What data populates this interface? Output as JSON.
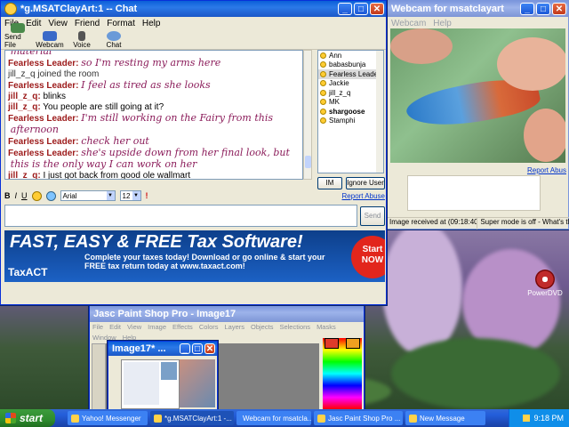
{
  "chat": {
    "title": "*g.MSATClayArt:1 -- Chat",
    "menu": [
      "File",
      "Edit",
      "View",
      "Friend",
      "Format",
      "Help"
    ],
    "tools": [
      {
        "label": "Send File",
        "icon": "send-file-icon",
        "color": "#4a8a4a"
      },
      {
        "label": "Webcam",
        "icon": "webcam-icon",
        "color": "#3a6ac8"
      },
      {
        "label": "Voice",
        "icon": "microphone-icon",
        "color": "#555555"
      },
      {
        "label": "Chat",
        "icon": "chat-bubble-icon",
        "color": "#6a9ad8"
      }
    ],
    "messages": [
      {
        "who": "",
        "text": "material",
        "style": "big"
      },
      {
        "who": "Fearless Leader:",
        "text": "so I'm resting my arms here",
        "style": "big"
      },
      {
        "who": "",
        "text": "jill_z_q joined the room",
        "style": "join"
      },
      {
        "who": "Fearless Leader:",
        "text": "I feel as tired as she looks",
        "style": "big"
      },
      {
        "who": "jill_z_q:",
        "text": "blinks",
        "style": "normal"
      },
      {
        "who": "jill_z_q:",
        "text": "You people are still going at it?",
        "style": "normal"
      },
      {
        "who": "Fearless Leader:",
        "text": "I'm still working on the Fairy from this",
        "style": "big"
      },
      {
        "who": "",
        "text": "afternoon",
        "style": "big"
      },
      {
        "who": "Fearless Leader:",
        "text": "check her out",
        "style": "big"
      },
      {
        "who": "Fearless Leader:",
        "text": "she's upside down from her final look, but",
        "style": "big"
      },
      {
        "who": "",
        "text": "this is the only way I can work on her",
        "style": "big"
      },
      {
        "who": "jill_z_q:",
        "text": "I just got back from good ole wallmart",
        "style": "normal"
      }
    ],
    "users": [
      {
        "name": "Ann",
        "selected": false,
        "bold": false
      },
      {
        "name": "babasbunja",
        "selected": false,
        "bold": false
      },
      {
        "name": "Fearless Leader",
        "selected": true,
        "bold": false
      },
      {
        "name": "Jackie",
        "selected": false,
        "bold": false
      },
      {
        "name": "jill_z_q",
        "selected": false,
        "bold": false
      },
      {
        "name": "MK",
        "selected": false,
        "bold": false
      },
      {
        "name": "shargoose",
        "selected": false,
        "bold": true
      },
      {
        "name": "Stamphi",
        "selected": false,
        "bold": false
      }
    ],
    "im_label": "IM",
    "ignore_label": "Ignore User",
    "report_abuse": "Report Abuse",
    "font_name": "Arial",
    "font_size": "12",
    "send_label": "Send",
    "ad": {
      "headline": "FAST, EASY & FREE Tax Software!",
      "body_line1": "Complete your taxes today! Download or go online & start your",
      "body_line2": "FREE tax return today at www.taxact.com!",
      "logo": "TaxACT",
      "cta_line1": "Start",
      "cta_line2": "NOW"
    }
  },
  "webcam": {
    "title": "Webcam for msatclayart",
    "menu": [
      "Webcam",
      "Help"
    ],
    "report_abuse": "Report Abus",
    "status_received": "Image received at (09:18:40 PM)",
    "status_super": "Super mode is off - What's this"
  },
  "desktop": {
    "icon_label": "PowerDVD"
  },
  "psp": {
    "title": "Jasc Paint Shop Pro - Image17",
    "menu": [
      "File",
      "Edit",
      "View",
      "Image",
      "Effects",
      "Colors",
      "Layers",
      "Objects",
      "Selections",
      "Masks",
      "Window",
      "Help"
    ],
    "image_title": "Image17* ..."
  },
  "taskbar": {
    "start_label": "start",
    "tasks": [
      {
        "label": "Yahoo! Messenger",
        "active": false
      },
      {
        "label": "*g.MSATClayArt:1 -...",
        "active": true
      },
      {
        "label": "Webcam for msatcla...",
        "active": false
      },
      {
        "label": "Jasc Paint Shop Pro ...",
        "active": false
      },
      {
        "label": "New Message",
        "active": false
      }
    ],
    "clock": "9:18 PM"
  }
}
